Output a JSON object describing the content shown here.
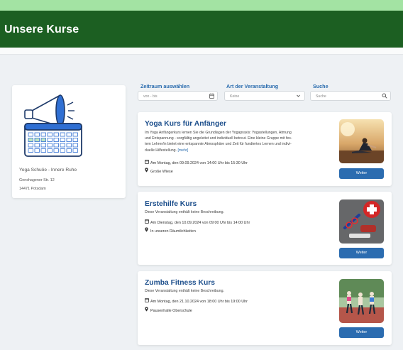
{
  "header": {
    "title": "Unsere Kurse"
  },
  "provider": {
    "name": "Yoga Schuöe - Innere Ruhe",
    "street": "Genshagener Str. 12",
    "city": "14471 Potsdam",
    "logo_icon": "megaphone-calendar-icon"
  },
  "filters": {
    "zeitraum": {
      "label": "Zeitraum auswählen",
      "placeholder": "von - bis",
      "icon": "calendar-icon"
    },
    "art": {
      "label": "Art der Veranstaltung",
      "value": "Keine",
      "icon": "chevron-down-icon"
    },
    "suche": {
      "label": "Suche",
      "placeholder": "Suche",
      "icon": "search-icon"
    }
  },
  "courses": [
    {
      "title": "Yoga Kurs für Anfänger",
      "desc_lines": [
        "Im Yoga Anfängerkurs lernen Sie die Grundlagen der Yogapraxis: Yogastellungen, Atmung",
        "und Entspannung - sorgfältig angeleitet und individuell betreut. Eine kleine Gruppe mit fes-",
        "tem Lehrer/in bietet eine entspannte Atmosphäre und Zeit für fundiertes Lernen und indivi-",
        "duelle Hilfestellung."
      ],
      "more": "[mehr]",
      "date": "Am Montag, den 09.09.2024 von 14:00 Uhr bis 15:30 Uhr",
      "location": "Große Wiese",
      "button": "Weiter"
    },
    {
      "title": "Erstehilfe Kurs",
      "desc_lines": [
        "Diese Veranstaltung enthält keine Beschreibung."
      ],
      "date": "Am Dienstag, den 10.09.2024 von 09:00 Uhr bis 14:00 Uhr",
      "location": "In unseren Räumlichkeiten",
      "button": "Weiter"
    },
    {
      "title": "Zumba Fitness Kurs",
      "desc_lines": [
        "Diese Veranstaltung enthält keine Beschreibung."
      ],
      "date": "Am Montag, den 21.10.2024 von 18:00 Uhr bis 19:00 Uhr",
      "location": "Pausenhalle Oberschule",
      "button": "Weiter"
    }
  ],
  "icons": {
    "date": "calendar-icon",
    "location": "location-pin-icon"
  },
  "colors": {
    "header": "#1c5f22",
    "topbar": "#a3e3a3",
    "accent": "#2b6cb0",
    "title": "#1d4f8c"
  }
}
